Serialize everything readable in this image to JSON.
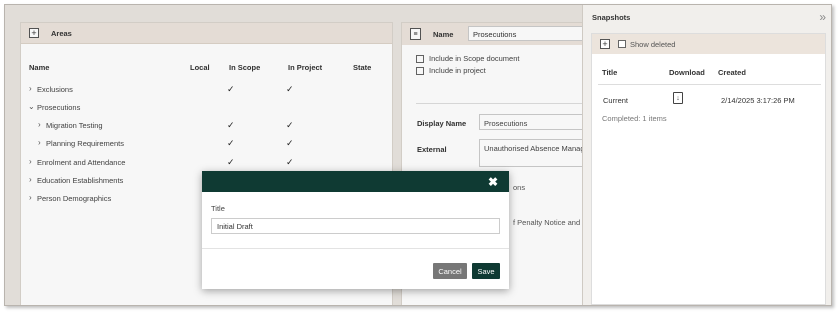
{
  "areas": {
    "title": "Areas",
    "add_icon": "plus-square-icon",
    "columns": {
      "name": "Name",
      "local": "Local",
      "in_scope": "In Scope",
      "in_project": "In Project",
      "state": "State"
    },
    "rows": [
      {
        "label": "Exclusions",
        "chevron": "›",
        "in_scope": "✓",
        "in_project": "✓"
      },
      {
        "label": "Prosecutions",
        "chevron": "⌄",
        "in_scope": "",
        "in_project": ""
      },
      {
        "label": "Migration Testing",
        "chevron": "›",
        "in_scope": "✓",
        "in_project": "✓"
      },
      {
        "label": "Planning Requirements",
        "chevron": "›",
        "in_scope": "✓",
        "in_project": "✓"
      },
      {
        "label": "Enrolment and Attendance",
        "chevron": "›",
        "in_scope": "✓",
        "in_project": "✓"
      },
      {
        "label": "Education Establishments",
        "chevron": "›",
        "in_scope": "",
        "in_project": ""
      },
      {
        "label": "Person Demographics",
        "chevron": "›",
        "in_scope": "",
        "in_project": ""
      }
    ]
  },
  "detail": {
    "name_label": "Name",
    "name_value": "Prosecutions",
    "include_scope_label": "Include in Scope document",
    "include_project_label": "Include in project",
    "display_name_label": "Display Name",
    "display_name_value": "Prosecutions",
    "external_label": "External",
    "external_value": "Unauthorised Absence Manage",
    "partial_1": "ons",
    "partial_2": "f Penalty Notice and Pr"
  },
  "snapshots": {
    "title": "Snapshots",
    "collapse_glyph": "»",
    "show_deleted_label": "Show deleted",
    "columns": {
      "title": "Title",
      "download": "Download",
      "created": "Created"
    },
    "rows": [
      {
        "title": "Current",
        "created": "2/14/2025 3:17:26 PM"
      }
    ],
    "completed_text": "Completed: 1 items"
  },
  "modal": {
    "close_glyph": "✖",
    "field_label": "Title",
    "field_value": "Initial Draft",
    "cancel_label": "Cancel",
    "save_label": "Save"
  },
  "colors": {
    "modal_header": "#0f3a33",
    "save_button": "#0f3a33",
    "cancel_button": "#777777",
    "panel_header": "#ece4dc"
  }
}
